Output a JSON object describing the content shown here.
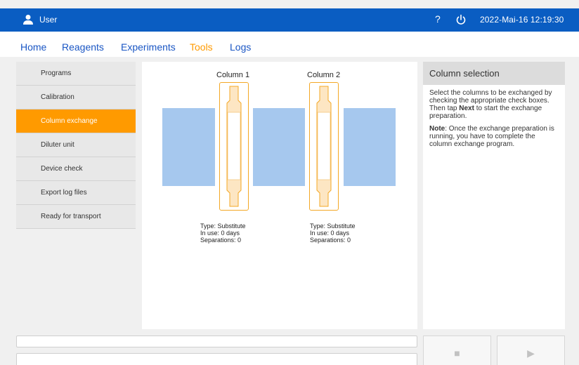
{
  "header": {
    "user_label": "User",
    "help_label": "?",
    "datetime": "2022-Mai-16  12:19:30"
  },
  "nav": {
    "items": [
      {
        "label": "Home",
        "active": false
      },
      {
        "label": "Reagents",
        "active": false
      },
      {
        "label": "Experiments",
        "active": false
      },
      {
        "label": "Tools",
        "active": true
      },
      {
        "label": "Logs",
        "active": false
      }
    ]
  },
  "sidebar": {
    "items": [
      {
        "label": "Programs",
        "active": false
      },
      {
        "label": "Calibration",
        "active": false
      },
      {
        "label": "Column exchange",
        "active": true
      },
      {
        "label": "Diluter unit",
        "active": false
      },
      {
        "label": "Device check",
        "active": false
      },
      {
        "label": "Export log files",
        "active": false
      },
      {
        "label": "Ready for transport",
        "active": false
      }
    ]
  },
  "columns": [
    {
      "title": "Column 1",
      "type": "Type: Substitute",
      "in_use": "In use: 0 days",
      "separations": "Separations: 0"
    },
    {
      "title": "Column 2",
      "type": "Type: Substitute",
      "in_use": "In use: 0 days",
      "separations": "Separations: 0"
    }
  ],
  "help": {
    "title": "Column selection",
    "p1_before": "Select the columns to be exchanged by checking the appropriate check boxes. Then tap ",
    "p1_bold": "Next",
    "p1_after": " to start the exchange preparation.",
    "p2_bold": "Note",
    "p2_after": ": Once the exchange preparation is running, you have to complete the column exchange program."
  },
  "controls": {
    "stop_icon": "stop-icon",
    "play_icon": "play-icon"
  },
  "colors": {
    "header_bg": "#0a5dc2",
    "accent": "#ff9a00",
    "block": "#a6c8ee",
    "column_outline": "#f4a825"
  }
}
